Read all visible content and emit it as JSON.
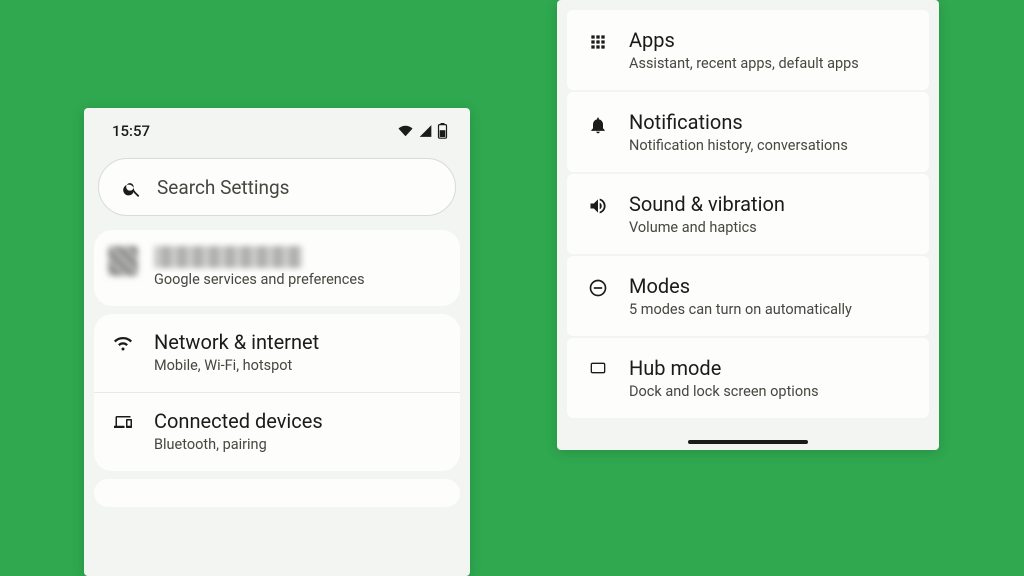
{
  "status_bar": {
    "time": "15:57"
  },
  "search": {
    "placeholder": "Search Settings"
  },
  "account": {
    "subtitle": "Google services and preferences"
  },
  "left_items": [
    {
      "icon": "wifi-icon",
      "title": "Network & internet",
      "sub": "Mobile, Wi-Fi, hotspot"
    },
    {
      "icon": "devices-icon",
      "title": "Connected devices",
      "sub": "Bluetooth, pairing"
    }
  ],
  "right_items": [
    {
      "icon": "apps-icon",
      "title": "Apps",
      "sub": "Assistant, recent apps, default apps"
    },
    {
      "icon": "bell-icon",
      "title": "Notifications",
      "sub": "Notification history, conversations"
    },
    {
      "icon": "volume-icon",
      "title": "Sound & vibration",
      "sub": "Volume and haptics"
    },
    {
      "icon": "dnd-icon",
      "title": "Modes",
      "sub": "5 modes can turn on automatically"
    },
    {
      "icon": "hub-icon",
      "title": "Hub mode",
      "sub": "Dock and lock screen options"
    }
  ]
}
